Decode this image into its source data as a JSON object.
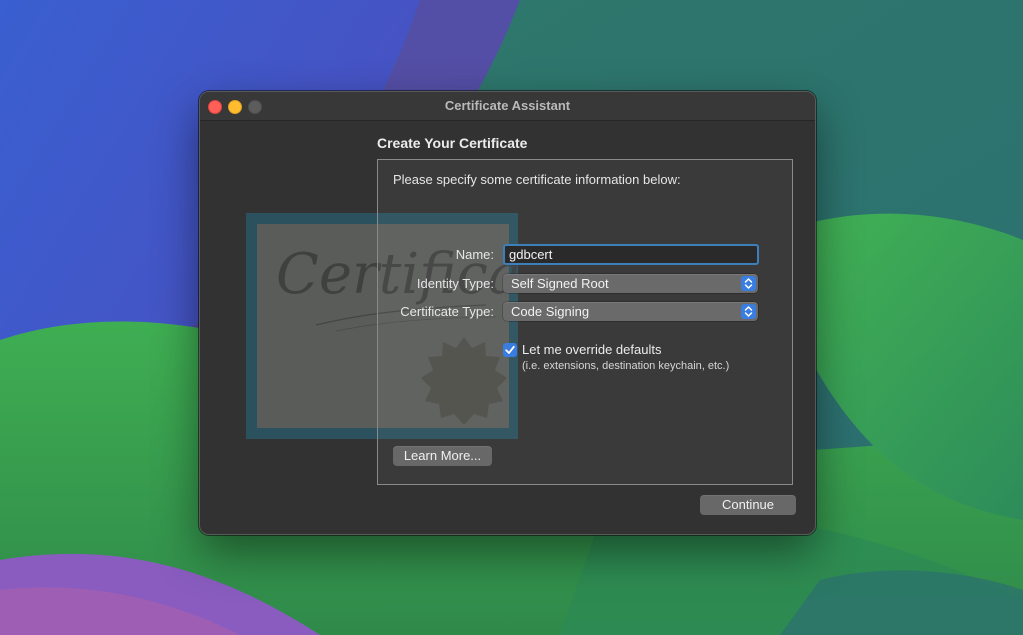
{
  "window": {
    "title": "Certificate Assistant"
  },
  "artwork": {
    "icon": "certificate-icon",
    "script_text": "Certificate"
  },
  "content": {
    "section_title": "Create Your Certificate",
    "instructions": "Please specify some certificate information below:",
    "fields": {
      "name": {
        "label": "Name:",
        "value": "gdbcert"
      },
      "identity_type": {
        "label": "Identity Type:",
        "value": "Self Signed Root"
      },
      "certificate_type": {
        "label": "Certificate Type:",
        "value": "Code Signing"
      }
    },
    "override": {
      "checked": true,
      "label": "Let me override defaults",
      "sublabel": "(i.e. extensions, destination keychain, etc.)"
    },
    "learn_more_label": "Learn More..."
  },
  "footer": {
    "continue_label": "Continue"
  },
  "colors": {
    "accent": "#3a7de0",
    "focus_ring": "#3d7fb8",
    "close": "#ff5f57",
    "minimize": "#febc2e"
  }
}
